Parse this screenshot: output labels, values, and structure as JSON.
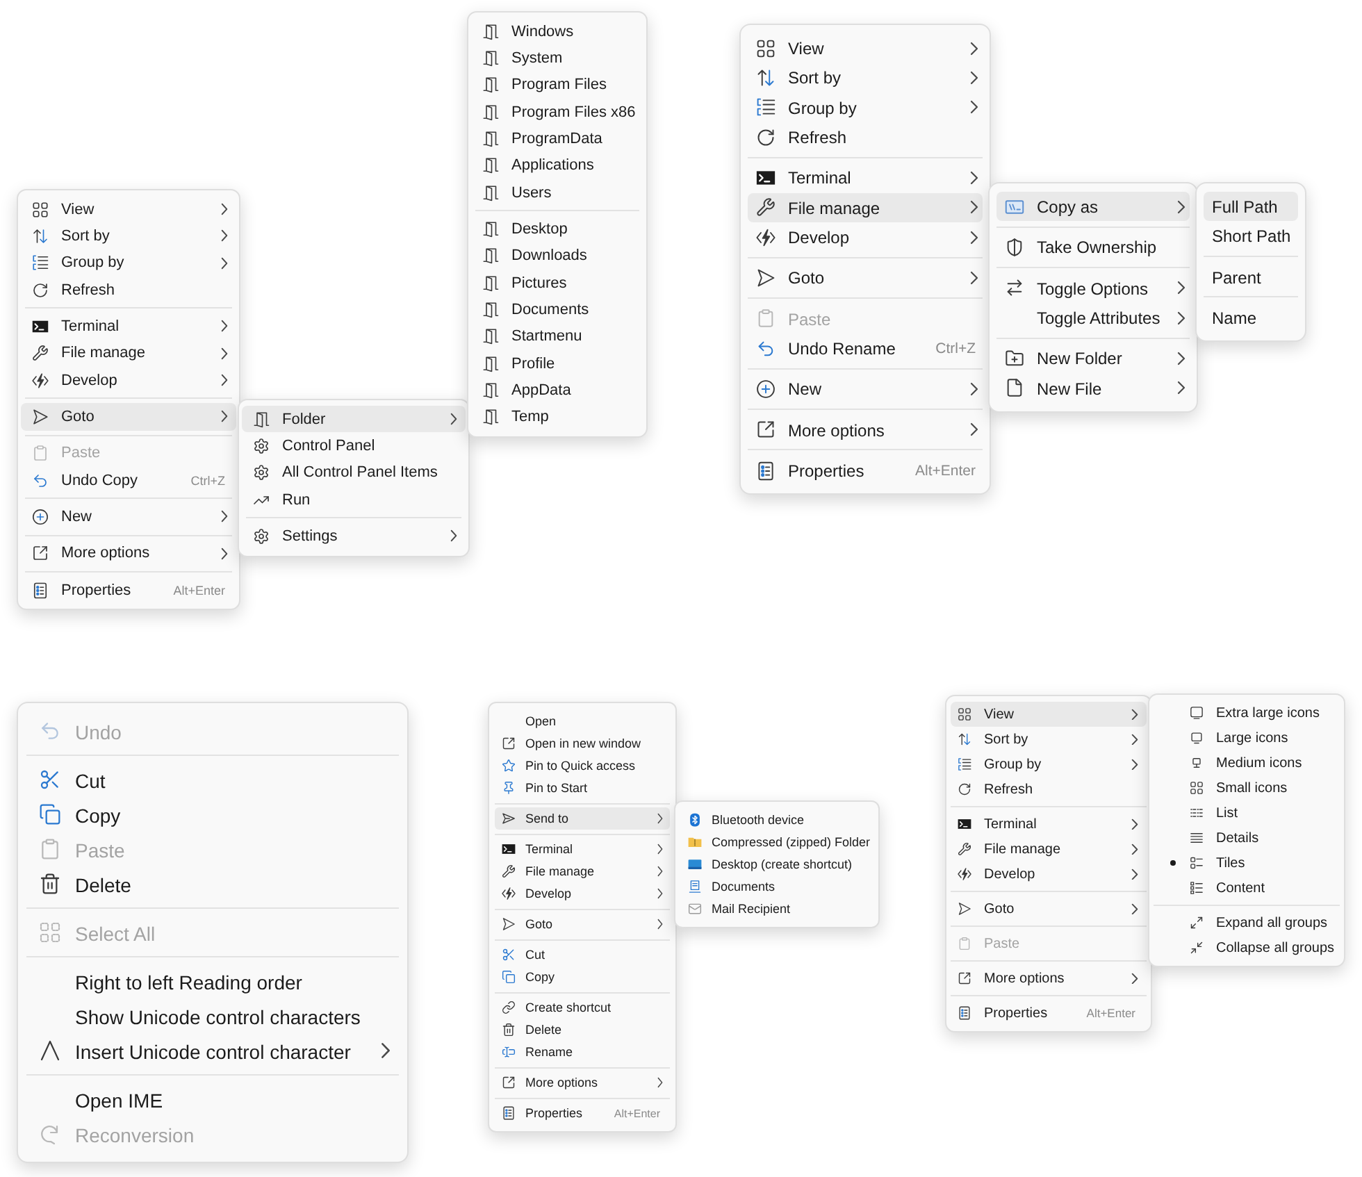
{
  "menus": [
    {
      "groups": [
        [
          {
            "label": "View",
            "submenu": true,
            "selected": false,
            "disabled": false
          },
          {
            "label": "Sort by",
            "submenu": true,
            "selected": false,
            "disabled": false
          },
          {
            "label": "Group by",
            "submenu": true,
            "selected": false,
            "disabled": false
          },
          {
            "label": "Refresh",
            "submenu": false,
            "selected": false,
            "disabled": false
          }
        ],
        [
          {
            "label": "Terminal",
            "submenu": true,
            "selected": false,
            "disabled": false
          },
          {
            "label": "File manage",
            "submenu": true,
            "selected": false,
            "disabled": false
          },
          {
            "label": "Develop",
            "submenu": true,
            "selected": false,
            "disabled": false
          }
        ],
        [
          {
            "label": "Goto",
            "submenu": true,
            "selected": true,
            "disabled": false
          }
        ],
        [
          {
            "label": "Paste",
            "submenu": false,
            "selected": false,
            "disabled": true
          },
          {
            "label": "Undo Copy",
            "shortcut": "Ctrl+Z",
            "submenu": false,
            "selected": false,
            "disabled": false
          }
        ],
        [
          {
            "label": "New",
            "submenu": true,
            "selected": false,
            "disabled": false
          }
        ],
        [
          {
            "label": "More options",
            "submenu": true,
            "selected": false,
            "disabled": false
          }
        ],
        [
          {
            "label": "Properties",
            "shortcut": "Alt+Enter",
            "submenu": false,
            "selected": false,
            "disabled": false
          }
        ]
      ]
    },
    {
      "groups": [
        [
          {
            "label": "Folder",
            "submenu": true,
            "selected": true,
            "disabled": false
          },
          {
            "label": "Control Panel",
            "submenu": false,
            "selected": false,
            "disabled": false
          },
          {
            "label": "All Control Panel Items",
            "submenu": false,
            "selected": false,
            "disabled": false
          },
          {
            "label": "Run",
            "submenu": false,
            "selected": false,
            "disabled": false
          }
        ],
        [
          {
            "label": "Settings",
            "submenu": true,
            "selected": false,
            "disabled": false
          }
        ]
      ]
    },
    {
      "groups": [
        [
          {
            "label": "Windows",
            "submenu": false,
            "selected": false,
            "disabled": false
          },
          {
            "label": "System",
            "submenu": false,
            "selected": false,
            "disabled": false
          },
          {
            "label": "Program Files",
            "submenu": false,
            "selected": false,
            "disabled": false
          },
          {
            "label": "Program Files x86",
            "submenu": false,
            "selected": false,
            "disabled": false
          },
          {
            "label": "ProgramData",
            "submenu": false,
            "selected": false,
            "disabled": false
          },
          {
            "label": "Applications",
            "submenu": false,
            "selected": false,
            "disabled": false
          },
          {
            "label": "Users",
            "submenu": false,
            "selected": false,
            "disabled": false
          }
        ],
        [
          {
            "label": "Desktop",
            "submenu": false,
            "selected": false,
            "disabled": false
          },
          {
            "label": "Downloads",
            "submenu": false,
            "selected": false,
            "disabled": false
          },
          {
            "label": "Pictures",
            "submenu": false,
            "selected": false,
            "disabled": false
          },
          {
            "label": "Documents",
            "submenu": false,
            "selected": false,
            "disabled": false
          },
          {
            "label": "Startmenu",
            "submenu": false,
            "selected": false,
            "disabled": false
          },
          {
            "label": "Profile",
            "submenu": false,
            "selected": false,
            "disabled": false
          },
          {
            "label": "AppData",
            "submenu": false,
            "selected": false,
            "disabled": false
          },
          {
            "label": "Temp",
            "submenu": false,
            "selected": false,
            "disabled": false
          }
        ]
      ]
    },
    {
      "groups": [
        [
          {
            "label": "View",
            "submenu": true,
            "selected": false,
            "disabled": false
          },
          {
            "label": "Sort by",
            "submenu": true,
            "selected": false,
            "disabled": false
          },
          {
            "label": "Group by",
            "submenu": true,
            "selected": false,
            "disabled": false
          },
          {
            "label": "Refresh",
            "submenu": false,
            "selected": false,
            "disabled": false
          }
        ],
        [
          {
            "label": "Terminal",
            "submenu": true,
            "selected": false,
            "disabled": false
          },
          {
            "label": "File manage",
            "submenu": true,
            "selected": true,
            "disabled": false
          },
          {
            "label": "Develop",
            "submenu": true,
            "selected": false,
            "disabled": false
          }
        ],
        [
          {
            "label": "Goto",
            "submenu": true,
            "selected": false,
            "disabled": false
          }
        ],
        [
          {
            "label": "Paste",
            "submenu": false,
            "selected": false,
            "disabled": true
          },
          {
            "label": "Undo Rename",
            "shortcut": "Ctrl+Z",
            "submenu": false,
            "selected": false,
            "disabled": false
          }
        ],
        [
          {
            "label": "New",
            "submenu": true,
            "selected": false,
            "disabled": false
          }
        ],
        [
          {
            "label": "More options",
            "submenu": true,
            "selected": false,
            "disabled": false
          }
        ],
        [
          {
            "label": "Properties",
            "shortcut": "Alt+Enter",
            "submenu": false,
            "selected": false,
            "disabled": false
          }
        ]
      ]
    },
    {
      "groups": [
        [
          {
            "label": "Copy as",
            "submenu": true,
            "selected": true,
            "disabled": false
          }
        ],
        [
          {
            "label": "Take Ownership",
            "submenu": false,
            "selected": false,
            "disabled": false
          }
        ],
        [
          {
            "label": "Toggle Options",
            "submenu": true,
            "selected": false,
            "disabled": false
          },
          {
            "label": "Toggle Attributes",
            "submenu": true,
            "selected": false,
            "disabled": false
          }
        ],
        [
          {
            "label": "New Folder",
            "submenu": true,
            "selected": false,
            "disabled": false
          },
          {
            "label": "New File",
            "submenu": true,
            "selected": false,
            "disabled": false
          }
        ]
      ]
    },
    {
      "groups": [
        [
          {
            "label": "Full Path",
            "submenu": false,
            "selected": true,
            "disabled": false
          },
          {
            "label": "Short Path",
            "submenu": false,
            "selected": false,
            "disabled": false
          }
        ],
        [
          {
            "label": "Parent",
            "submenu": false,
            "selected": false,
            "disabled": false
          }
        ],
        [
          {
            "label": "Name",
            "submenu": false,
            "selected": false,
            "disabled": false
          }
        ]
      ]
    },
    {
      "groups": [
        [
          {
            "label": "Undo",
            "submenu": false,
            "selected": false,
            "disabled": true
          }
        ],
        [
          {
            "label": "Cut",
            "submenu": false,
            "selected": false,
            "disabled": false
          },
          {
            "label": "Copy",
            "submenu": false,
            "selected": false,
            "disabled": false
          },
          {
            "label": "Paste",
            "submenu": false,
            "selected": false,
            "disabled": true
          },
          {
            "label": "Delete",
            "submenu": false,
            "selected": false,
            "disabled": false
          }
        ],
        [
          {
            "label": "Select All",
            "submenu": false,
            "selected": false,
            "disabled": true
          }
        ],
        [
          {
            "label": "Right to left Reading order",
            "submenu": false,
            "selected": false,
            "disabled": false
          },
          {
            "label": "Show Unicode control characters",
            "submenu": false,
            "selected": false,
            "disabled": false
          },
          {
            "label": "Insert Unicode control character",
            "submenu": true,
            "selected": false,
            "disabled": false
          }
        ],
        [
          {
            "label": "Open IME",
            "submenu": false,
            "selected": false,
            "disabled": false
          },
          {
            "label": "Reconversion",
            "submenu": false,
            "selected": false,
            "disabled": true
          }
        ]
      ]
    },
    {
      "groups": [
        [
          {
            "label": "Open",
            "submenu": false,
            "selected": false,
            "disabled": false
          },
          {
            "label": "Open in new window",
            "submenu": false,
            "selected": false,
            "disabled": false
          },
          {
            "label": "Pin to Quick access",
            "submenu": false,
            "selected": false,
            "disabled": false
          },
          {
            "label": "Pin to Start",
            "submenu": false,
            "selected": false,
            "disabled": false
          }
        ],
        [
          {
            "label": "Send to",
            "submenu": true,
            "selected": true,
            "disabled": false
          }
        ],
        [
          {
            "label": "Terminal",
            "submenu": true,
            "selected": false,
            "disabled": false
          },
          {
            "label": "File manage",
            "submenu": true,
            "selected": false,
            "disabled": false
          },
          {
            "label": "Develop",
            "submenu": true,
            "selected": false,
            "disabled": false
          }
        ],
        [
          {
            "label": "Goto",
            "submenu": true,
            "selected": false,
            "disabled": false
          }
        ],
        [
          {
            "label": "Cut",
            "submenu": false,
            "selected": false,
            "disabled": false
          },
          {
            "label": "Copy",
            "submenu": false,
            "selected": false,
            "disabled": false
          }
        ],
        [
          {
            "label": "Create shortcut",
            "submenu": false,
            "selected": false,
            "disabled": false
          },
          {
            "label": "Delete",
            "submenu": false,
            "selected": false,
            "disabled": false
          },
          {
            "label": "Rename",
            "submenu": false,
            "selected": false,
            "disabled": false
          }
        ],
        [
          {
            "label": "More options",
            "submenu": true,
            "selected": false,
            "disabled": false
          }
        ],
        [
          {
            "label": "Properties",
            "shortcut": "Alt+Enter",
            "submenu": false,
            "selected": false,
            "disabled": false
          }
        ]
      ]
    },
    {
      "groups": [
        [
          {
            "label": "Bluetooth device",
            "submenu": false,
            "selected": false,
            "disabled": false
          },
          {
            "label": "Compressed (zipped) Folder",
            "submenu": false,
            "selected": false,
            "disabled": false
          },
          {
            "label": "Desktop (create shortcut)",
            "submenu": false,
            "selected": false,
            "disabled": false
          },
          {
            "label": "Documents",
            "submenu": false,
            "selected": false,
            "disabled": false
          },
          {
            "label": "Mail Recipient",
            "submenu": false,
            "selected": false,
            "disabled": false
          }
        ]
      ]
    },
    {
      "groups": [
        [
          {
            "label": "View",
            "submenu": true,
            "selected": true,
            "disabled": false
          },
          {
            "label": "Sort by",
            "submenu": true,
            "selected": false,
            "disabled": false
          },
          {
            "label": "Group by",
            "submenu": true,
            "selected": false,
            "disabled": false
          },
          {
            "label": "Refresh",
            "submenu": false,
            "selected": false,
            "disabled": false
          }
        ],
        [
          {
            "label": "Terminal",
            "submenu": true,
            "selected": false,
            "disabled": false
          },
          {
            "label": "File manage",
            "submenu": true,
            "selected": false,
            "disabled": false
          },
          {
            "label": "Develop",
            "submenu": true,
            "selected": false,
            "disabled": false
          }
        ],
        [
          {
            "label": "Goto",
            "submenu": true,
            "selected": false,
            "disabled": false
          }
        ],
        [
          {
            "label": "Paste",
            "submenu": false,
            "selected": false,
            "disabled": true
          }
        ],
        [
          {
            "label": "More options",
            "submenu": true,
            "selected": false,
            "disabled": false
          }
        ],
        [
          {
            "label": "Properties",
            "shortcut": "Alt+Enter",
            "submenu": false,
            "selected": false,
            "disabled": false
          }
        ]
      ]
    },
    {
      "groups": [
        [
          {
            "label": "Extra large icons",
            "checked": false,
            "submenu": false,
            "selected": false,
            "disabled": false
          },
          {
            "label": "Large icons",
            "checked": false,
            "submenu": false,
            "selected": false,
            "disabled": false
          },
          {
            "label": "Medium icons",
            "checked": false,
            "submenu": false,
            "selected": false,
            "disabled": false
          },
          {
            "label": "Small icons",
            "checked": false,
            "submenu": false,
            "selected": false,
            "disabled": false
          },
          {
            "label": "List",
            "checked": false,
            "submenu": false,
            "selected": false,
            "disabled": false
          },
          {
            "label": "Details",
            "checked": false,
            "submenu": false,
            "selected": false,
            "disabled": false
          },
          {
            "label": "Tiles",
            "checked": true,
            "submenu": false,
            "selected": false,
            "disabled": false
          },
          {
            "label": "Content",
            "checked": false,
            "submenu": false,
            "selected": false,
            "disabled": false
          }
        ],
        [
          {
            "label": "Expand all groups",
            "checked": false,
            "submenu": false,
            "selected": false,
            "disabled": false
          },
          {
            "label": "Collapse all groups",
            "checked": false,
            "submenu": false,
            "selected": false,
            "disabled": false
          }
        ]
      ]
    }
  ]
}
